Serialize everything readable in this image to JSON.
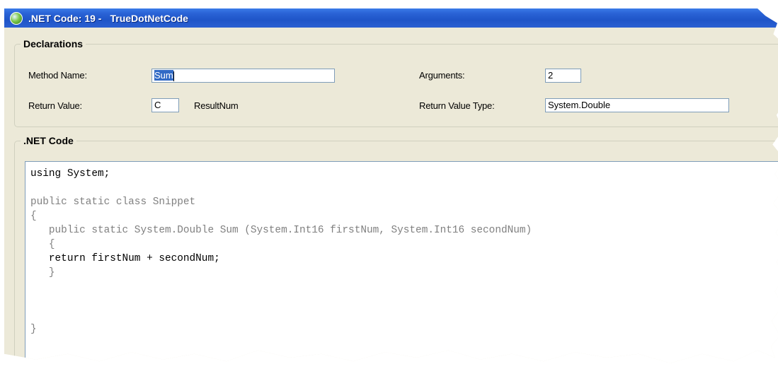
{
  "window": {
    "title_prefix": ".NET Code: 19 -",
    "title_name": "TrueDotNetCode"
  },
  "declarations": {
    "legend": "Declarations",
    "method_name_label": "Method Name:",
    "method_name_value": "Sum",
    "arguments_label": "Arguments:",
    "arguments_value": "2",
    "return_value_label": "Return Value:",
    "return_value_value": "C",
    "return_value_var": "ResultNum",
    "return_value_type_label": "Return Value Type:",
    "return_value_type_value": "System.Double"
  },
  "net_code": {
    "legend": ".NET Code",
    "lines": [
      {
        "text": "using System;",
        "tone": "dark"
      },
      {
        "text": "",
        "tone": "dark"
      },
      {
        "text": "public static class Snippet",
        "tone": "gray"
      },
      {
        "text": "{",
        "tone": "gray"
      },
      {
        "text": "   public static System.Double Sum (System.Int16 firstNum, System.Int16 secondNum)",
        "tone": "gray"
      },
      {
        "text": "   {",
        "tone": "gray"
      },
      {
        "text": "   return firstNum + secondNum;",
        "tone": "dark"
      },
      {
        "text": "   }",
        "tone": "gray"
      },
      {
        "text": "",
        "tone": "dark"
      },
      {
        "text": "",
        "tone": "dark"
      },
      {
        "text": "",
        "tone": "dark"
      },
      {
        "text": "}",
        "tone": "gray"
      }
    ]
  },
  "colors": {
    "titlebar": "#2a63d6",
    "window_bg": "#ece9d8",
    "selection": "#316ac5",
    "input_border": "#7f9db9"
  }
}
